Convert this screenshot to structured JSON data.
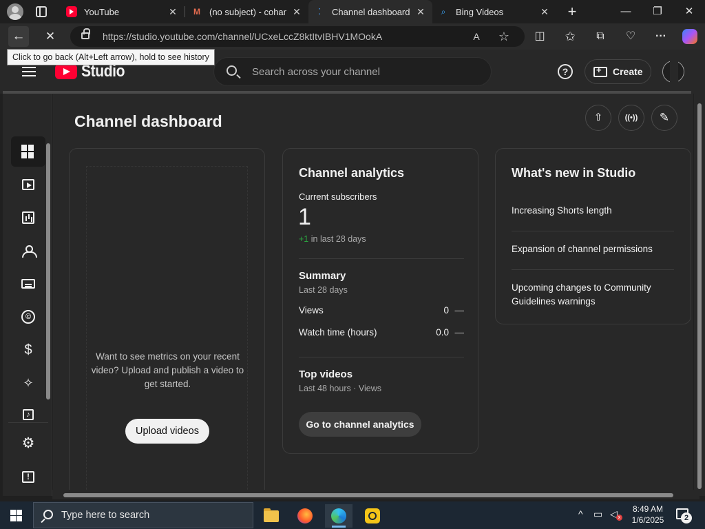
{
  "browser": {
    "tabs": [
      {
        "title": "YouTube",
        "icon": "youtube-favicon"
      },
      {
        "title": "(no subject) - cohamm",
        "icon": "gmail-favicon"
      },
      {
        "title": "Channel dashboard - Y",
        "icon": "studio-favicon",
        "active": true
      },
      {
        "title": "Bing Videos",
        "icon": "bing-favicon"
      }
    ],
    "close_glyph": "✕",
    "new_tab_glyph": "+",
    "window_controls": {
      "minimize": "—",
      "maximize": "❐",
      "close": "✕"
    },
    "url": "https://studio.youtube.com/channel/UCxeLccZ8ktItvIBHV1MOokA",
    "tooltip": "Click to go back (Alt+Left arrow), hold to see history",
    "read_aloud_glyph": "A",
    "toolbar_glyphs": {
      "back": "←",
      "reload": "✕",
      "favorite": "☆",
      "split": "◫",
      "favorites": "✩",
      "collections": "⧉",
      "health": "♡",
      "more": "···"
    }
  },
  "studio": {
    "logo_text": "Studio",
    "search_placeholder": "Search across your channel",
    "help_glyph": "?",
    "create_label": "Create",
    "nav": [
      {
        "name": "dashboard",
        "icon": "dashboard-icon",
        "active": true
      },
      {
        "name": "content",
        "icon": "content-icon"
      },
      {
        "name": "analytics",
        "icon": "analytics-icon"
      },
      {
        "name": "community",
        "icon": "community-icon"
      },
      {
        "name": "subtitles",
        "icon": "subtitles-icon"
      },
      {
        "name": "copyright",
        "icon": "copyright-icon"
      },
      {
        "name": "earn",
        "icon": "dollar-icon"
      },
      {
        "name": "customization",
        "icon": "magic-wand-icon"
      },
      {
        "name": "audio-library",
        "icon": "music-icon"
      },
      {
        "name": "settings",
        "icon": "gear-icon"
      },
      {
        "name": "feedback",
        "icon": "feedback-icon"
      }
    ],
    "nav_glyphs": {
      "copyright": "©",
      "earn": "$",
      "customization": "✧",
      "audio": "♪",
      "settings": "⚙",
      "feedback": "!"
    },
    "page_title": "Channel dashboard",
    "header_action_glyphs": {
      "upload": "⇧",
      "live": "((•))",
      "post": "✎"
    },
    "upload_card": {
      "message": "Want to see metrics on your recent video? Upload and publish a video to get started.",
      "button": "Upload videos"
    },
    "analytics_card": {
      "title": "Channel analytics",
      "subscribers_label": "Current subscribers",
      "subscribers_value": "1",
      "delta_value": "+1",
      "delta_label": "in last 28 days",
      "summary_title": "Summary",
      "summary_period": "Last 28 days",
      "metrics": [
        {
          "label": "Views",
          "value": "0",
          "trend": "—"
        },
        {
          "label": "Watch time (hours)",
          "value": "0.0",
          "trend": "—"
        }
      ],
      "top_videos_title": "Top videos",
      "top_videos_period": "Last 48 hours · Views",
      "button": "Go to channel analytics"
    },
    "news_card": {
      "title": "What's new in Studio",
      "items": [
        "Increasing Shorts length",
        "Expansion of channel permissions",
        "Upcoming changes to Community Guidelines warnings"
      ]
    }
  },
  "taskbar": {
    "search_placeholder": "Type here to search",
    "time": "8:49 AM",
    "date": "1/6/2025",
    "notification_count": "2",
    "tray_glyphs": {
      "chevron": "^",
      "network": "▭",
      "volume": "◁",
      "mute": "x"
    }
  },
  "colors": {
    "accent_red": "#ff0033",
    "positive_green": "#2ba640",
    "background": "#282828"
  }
}
